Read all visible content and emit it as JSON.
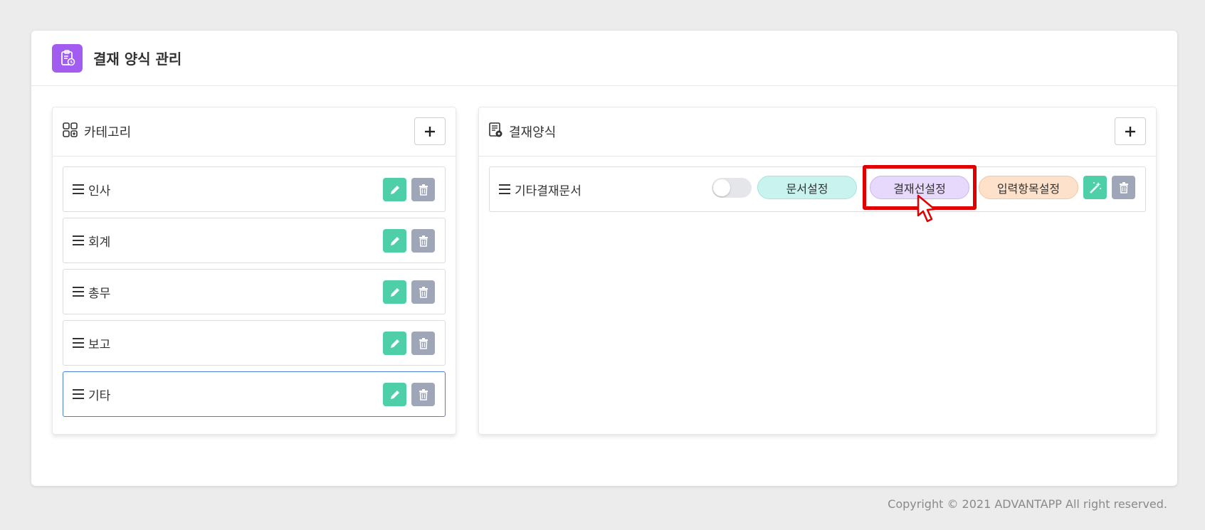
{
  "app": {
    "title": "결재 양식 관리",
    "icon": "clipboard-icon",
    "accent_color": "#a35cf0"
  },
  "category_panel": {
    "title": "카테고리",
    "icon": "grid-icon",
    "add_label": "+",
    "items": [
      {
        "label": "인사",
        "selected": false
      },
      {
        "label": "회계",
        "selected": false
      },
      {
        "label": "총무",
        "selected": false
      },
      {
        "label": "보고",
        "selected": false
      },
      {
        "label": "기타",
        "selected": true
      }
    ]
  },
  "form_panel": {
    "title": "결재양식",
    "icon": "document-icon",
    "add_label": "+",
    "items": [
      {
        "label": "기타결재문서",
        "toggle_on": false,
        "doc_settings_label": "문서설정",
        "line_settings_label": "결재선설정",
        "input_settings_label": "입력항목설정"
      }
    ]
  },
  "colors": {
    "edit_button": "#4fcfa8",
    "delete_button": "#9ea6b8",
    "highlight_box": "#e00000",
    "selected_border": "#4a7fd8"
  },
  "footer": {
    "copyright": "Copyright © 2021 ADVANTAPP All right reserved."
  }
}
